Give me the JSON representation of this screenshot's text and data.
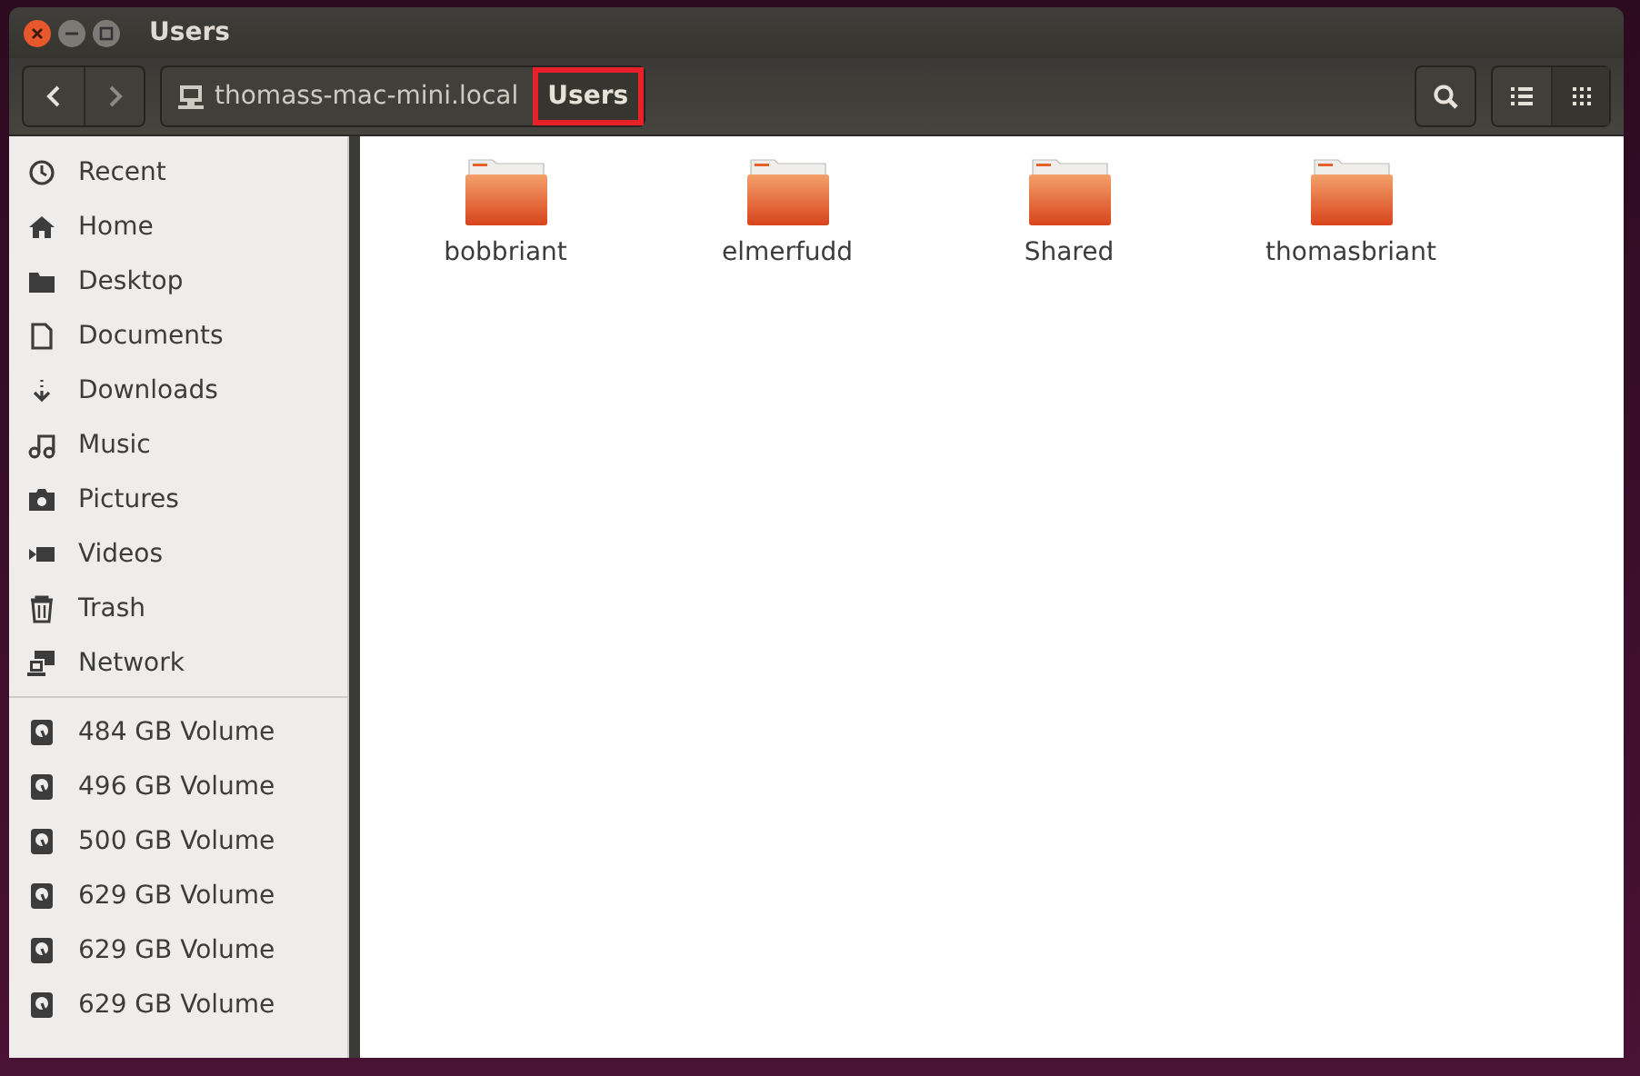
{
  "window": {
    "title": "Users"
  },
  "toolbar": {
    "breadcrumbs": [
      {
        "label": "thomass-mac-mini.local",
        "kind": "host",
        "selected": false,
        "highlighted": false
      },
      {
        "label": "Users",
        "kind": "folder",
        "selected": true,
        "highlighted": true
      }
    ],
    "view_modes": [
      {
        "kind": "list",
        "selected": false
      },
      {
        "kind": "grid",
        "selected": true
      }
    ]
  },
  "sidebar": {
    "places": [
      {
        "label": "Recent",
        "kind": "recent"
      },
      {
        "label": "Home",
        "kind": "home"
      },
      {
        "label": "Desktop",
        "kind": "folder"
      },
      {
        "label": "Documents",
        "kind": "document"
      },
      {
        "label": "Downloads",
        "kind": "download"
      },
      {
        "label": "Music",
        "kind": "music"
      },
      {
        "label": "Pictures",
        "kind": "camera"
      },
      {
        "label": "Videos",
        "kind": "video"
      },
      {
        "label": "Trash",
        "kind": "trash"
      },
      {
        "label": "Network",
        "kind": "network"
      }
    ],
    "devices": [
      {
        "label": "484 GB Volume",
        "kind": "drive"
      },
      {
        "label": "496 GB Volume",
        "kind": "drive"
      },
      {
        "label": "500 GB Volume",
        "kind": "drive"
      },
      {
        "label": "629 GB Volume",
        "kind": "drive"
      },
      {
        "label": "629 GB Volume",
        "kind": "drive"
      },
      {
        "label": "629 GB Volume",
        "kind": "drive"
      }
    ]
  },
  "files": [
    {
      "name": "bobbriant"
    },
    {
      "name": "elmerfudd"
    },
    {
      "name": "Shared"
    },
    {
      "name": "thomasbriant"
    }
  ]
}
